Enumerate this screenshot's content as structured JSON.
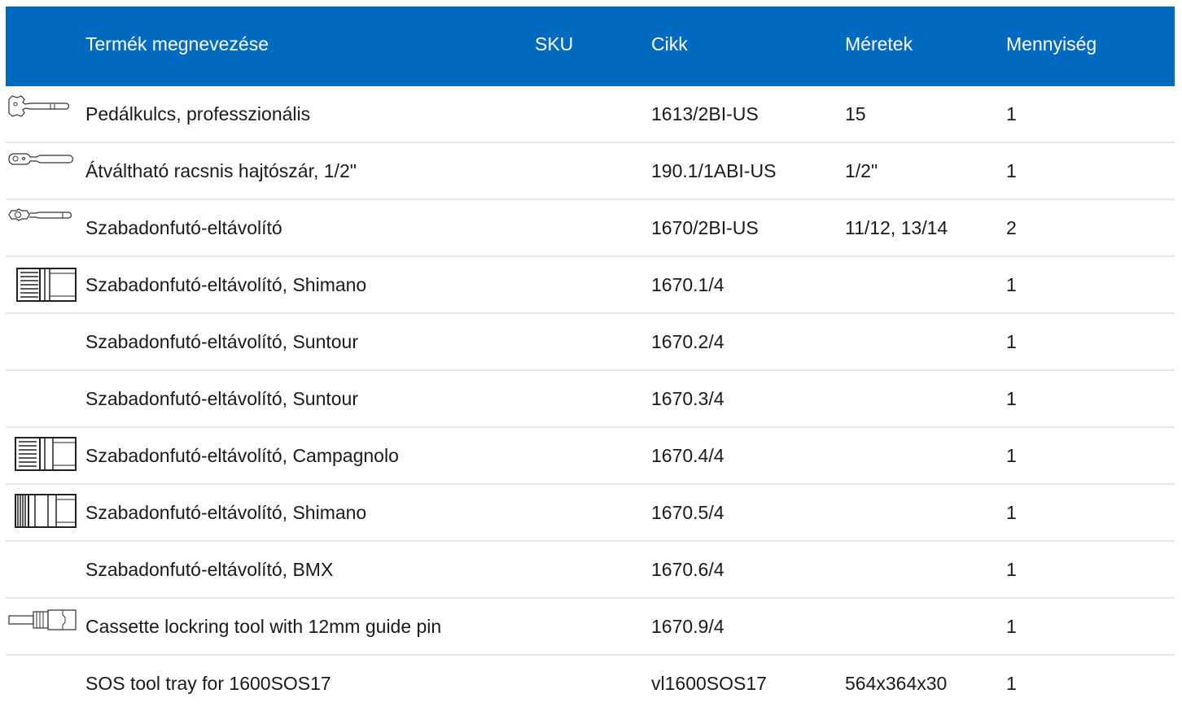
{
  "table": {
    "headers": {
      "name": "Termék megnevezése",
      "sku": "SKU",
      "cikk": "Cikk",
      "meretek": "Méretek",
      "mennyiseg": "Mennyiség"
    },
    "rows": [
      {
        "name": "Pedálkulcs, professzionális",
        "sku_icon": "pedal-wrench-icon",
        "cikk": "1613/2BI-US",
        "meretek": "15",
        "mennyiseg": "1"
      },
      {
        "name": "Átváltható racsnis hajtószár, 1/2\"",
        "sku_icon": "ratchet-handle-icon",
        "cikk": "190.1/1ABI-US",
        "meretek": "1/2\"",
        "mennyiseg": "1"
      },
      {
        "name": "Szabadonfutó-eltávolító",
        "sku_icon": "freewheel-wrench-icon",
        "cikk": "1670/2BI-US",
        "meretek": "11/12, 13/14",
        "mennyiseg": "2"
      },
      {
        "name": "Szabadonfutó-eltávolító, Shimano",
        "sku_icon": "freewheel-socket-icon",
        "cikk": "1670.1/4",
        "meretek": "",
        "mennyiseg": "1"
      },
      {
        "name": "Szabadonfutó-eltávolító, Suntour",
        "sku_icon": "",
        "cikk": "1670.2/4",
        "meretek": "",
        "mennyiseg": "1"
      },
      {
        "name": "Szabadonfutó-eltávolító, Suntour",
        "sku_icon": "",
        "cikk": "1670.3/4",
        "meretek": "",
        "mennyiseg": "1"
      },
      {
        "name": "Szabadonfutó-eltávolító, Campagnolo",
        "sku_icon": "freewheel-socket-icon",
        "cikk": "1670.4/4",
        "meretek": "",
        "mennyiseg": "1"
      },
      {
        "name": "Szabadonfutó-eltávolító, Shimano",
        "sku_icon": "freewheel-socket-icon",
        "cikk": "1670.5/4",
        "meretek": "",
        "mennyiseg": "1"
      },
      {
        "name": "Szabadonfutó-eltávolító, BMX",
        "sku_icon": "",
        "cikk": "1670.6/4",
        "meretek": "",
        "mennyiseg": "1"
      },
      {
        "name": "Cassette lockring tool with 12mm guide pin",
        "sku_icon": "lockring-tool-icon",
        "cikk": "1670.9/4",
        "meretek": "",
        "mennyiseg": "1"
      },
      {
        "name": "SOS tool tray for 1600SOS17",
        "sku_icon": "",
        "cikk": "vl1600SOS17",
        "meretek": "564x364x30",
        "mennyiseg": "1"
      }
    ]
  }
}
